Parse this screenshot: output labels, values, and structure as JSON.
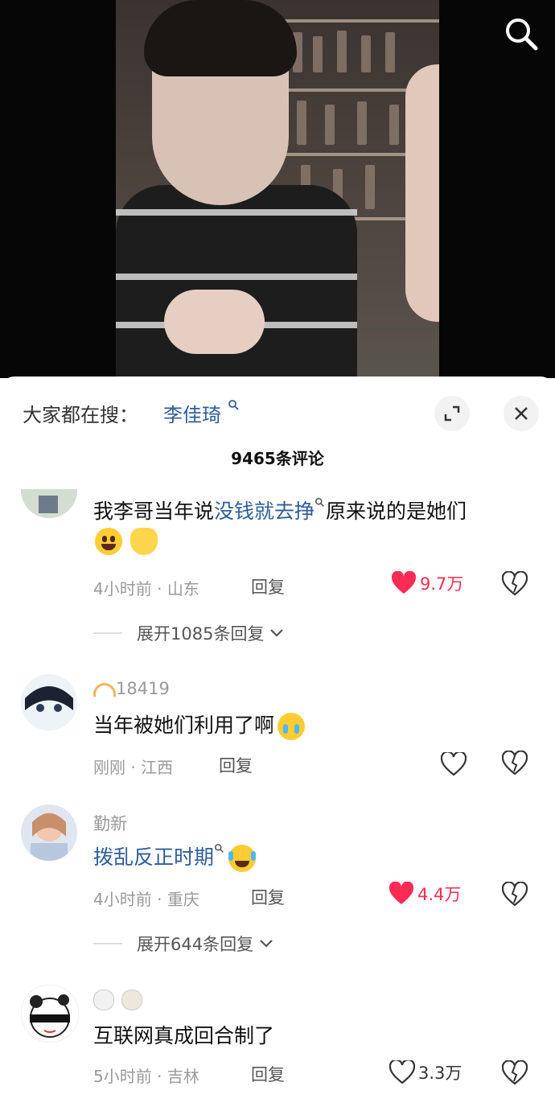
{
  "header": {
    "search_label": "大家都在搜：",
    "search_term": "李佳琦",
    "comment_count": "9465条评论"
  },
  "comments": [
    {
      "text_prefix": "我李哥当年说",
      "text_link": "没钱就去挣",
      "text_suffix": "原来说的是她们",
      "meta_time": "4小时前",
      "meta_dot": " · ",
      "meta_location": "山东",
      "reply_label": "回复",
      "likes": "9.7万",
      "expand_label": "展开1085条回复"
    },
    {
      "username": "18419",
      "text": "当年被她们利用了啊",
      "meta_time": "刚刚",
      "meta_dot": " · ",
      "meta_location": "江西",
      "reply_label": "回复"
    },
    {
      "username": "勤新",
      "text_link": "拨乱反正时期",
      "meta_time": "4小时前",
      "meta_dot": " · ",
      "meta_location": "重庆",
      "reply_label": "回复",
      "likes": "4.4万",
      "expand_label": "展开644条回复"
    },
    {
      "text": "互联网真成回合制了",
      "meta_time": "5小时前",
      "meta_dot": " · ",
      "meta_location": "吉林",
      "reply_label": "回复",
      "likes": "3.3万"
    }
  ],
  "colors": {
    "like_red": "#fe2c55",
    "link_blue": "#2f5d9b",
    "meta_gray": "#9a9a9a"
  },
  "icons": {
    "search": "search-icon",
    "close": "close-icon",
    "expand": "expand-icon",
    "heart": "heart-icon",
    "broken_heart": "broken-heart-icon",
    "chevron": "chevron-down-icon"
  }
}
